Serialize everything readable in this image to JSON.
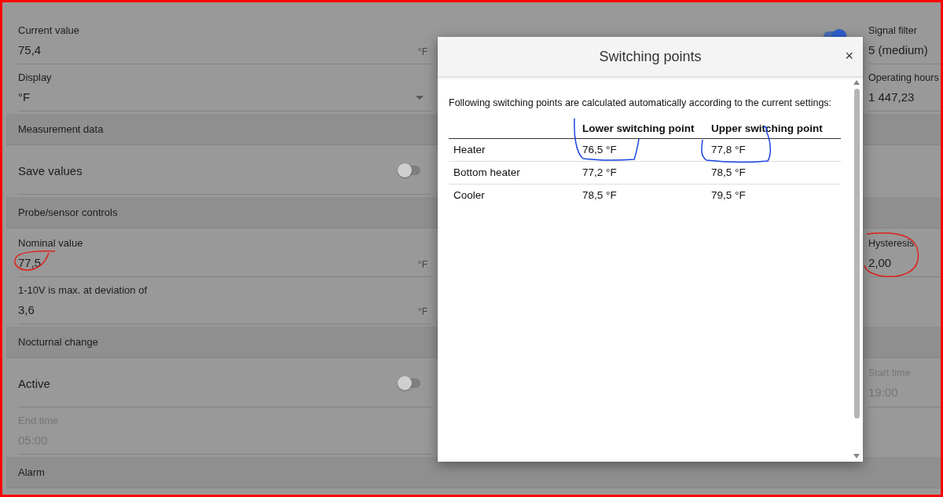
{
  "rows": [
    {
      "kind": "field",
      "label": "Current value",
      "value": "75,4",
      "unit": "°F",
      "middle": {
        "on": true
      },
      "right": {
        "label": "Signal filter",
        "value": "5 (medium)",
        "disabled": false
      }
    },
    {
      "kind": "select",
      "label": "Display",
      "value": "°F",
      "right": {
        "label": "Operating hours",
        "value": "1 447,23",
        "disabled": false
      }
    },
    {
      "kind": "section",
      "label": "Measurement data"
    },
    {
      "kind": "toggle",
      "label": "Save values",
      "on": false
    },
    {
      "kind": "section",
      "label": "Probe/sensor controls"
    },
    {
      "kind": "field",
      "label": "Nominal value",
      "value": "77,5",
      "unit": "°F",
      "right": {
        "label": "Hysteresis",
        "value": "2,00",
        "disabled": false
      }
    },
    {
      "kind": "field",
      "label": "1-10V is max. at deviation of",
      "value": "3,6",
      "unit": "°F"
    },
    {
      "kind": "section",
      "label": "Nocturnal change"
    },
    {
      "kind": "toggle",
      "label": "Active",
      "on": false,
      "right": {
        "label": "Start time",
        "value": "19:00",
        "disabled": true
      }
    },
    {
      "kind": "field",
      "label": "End time",
      "value": "05:00",
      "disabled": true
    },
    {
      "kind": "section",
      "label": "Alarm"
    }
  ],
  "dialog": {
    "title": "Switching points",
    "close": "×",
    "intro": "Following switching points are calculated automatically according to the current settings:",
    "columns": [
      "Lower switching point",
      "Upper switching point"
    ],
    "rows": [
      {
        "name": "Heater",
        "lower": "76,5 °F",
        "upper": "77,8 °F"
      },
      {
        "name": "Bottom heater",
        "lower": "77,2 °F",
        "upper": "78,5 °F"
      },
      {
        "name": "Cooler",
        "lower": "78,5 °F",
        "upper": "79,5 °F"
      }
    ]
  }
}
